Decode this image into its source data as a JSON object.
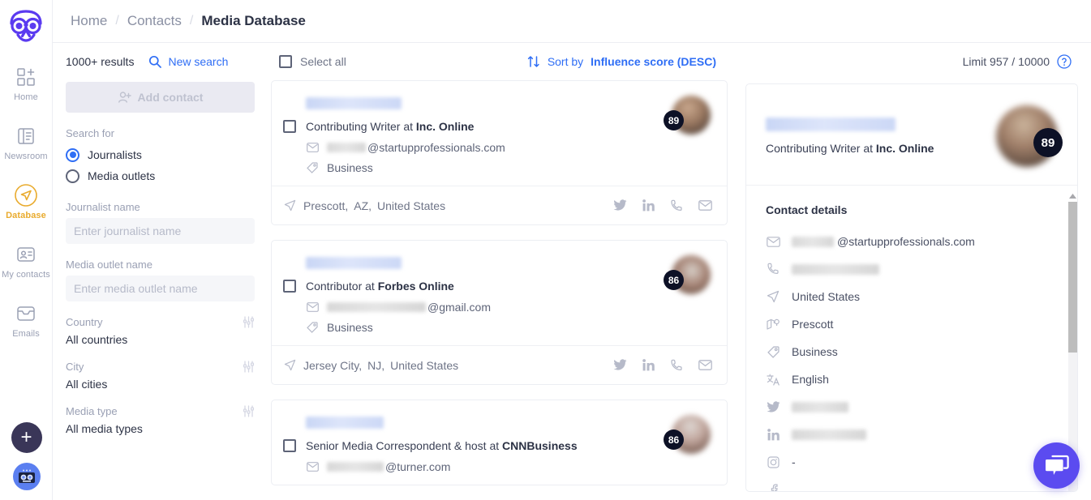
{
  "brand": {
    "logo_icon": "owl-logo",
    "accent_blue": "#2f6ef5",
    "accent_purple": "#5b4bf0",
    "accent_gold": "#e9ab2e",
    "score_bg": "#0d1126"
  },
  "sidebar": {
    "items": [
      {
        "label": "Home",
        "icon": "dashboard-add-icon",
        "active": false
      },
      {
        "label": "Newsroom",
        "icon": "book-icon",
        "active": false
      },
      {
        "label": "Database",
        "icon": "paper-plane-icon",
        "active": true
      },
      {
        "label": "My contacts",
        "icon": "contact-card-icon",
        "active": false
      },
      {
        "label": "Emails",
        "icon": "inbox-icon",
        "active": false
      }
    ],
    "add_button_icon": "plus-icon",
    "avatar_icon": "robot-avatar-icon"
  },
  "breadcrumb": {
    "items": [
      {
        "label": "Home"
      },
      {
        "label": "Contacts"
      },
      {
        "label": "Media Database"
      }
    ],
    "separator": "/"
  },
  "filters": {
    "results_count": "1000+ results",
    "new_search_label": "New search",
    "new_search_icon": "search-icon",
    "add_contact_label": "Add contact",
    "add_contact_icon": "person-add-icon",
    "search_for_label": "Search for",
    "radio_options": [
      {
        "label": "Journalists",
        "selected": true
      },
      {
        "label": "Media outlets",
        "selected": false
      }
    ],
    "journalist_name_label": "Journalist name",
    "journalist_name_placeholder": "Enter journalist name",
    "journalist_name_value": "",
    "media_outlet_label": "Media outlet name",
    "media_outlet_placeholder": "Enter media outlet name",
    "media_outlet_value": "",
    "groups": [
      {
        "title": "Country",
        "value": "All countries",
        "icon": "sliders-icon"
      },
      {
        "title": "City",
        "value": "All cities",
        "icon": "sliders-icon"
      },
      {
        "title": "Media type",
        "value": "All media types",
        "icon": "sliders-icon"
      }
    ]
  },
  "results_header": {
    "select_all_label": "Select all",
    "sort_icon": "sort-arrows-icon",
    "sort_prefix": "Sort by",
    "sort_value": "Influence score (DESC)",
    "limit_label": "Limit 957 / 10000",
    "help_icon": "question-mark-icon"
  },
  "results": [
    {
      "name_redacted": true,
      "title_prefix": "Contributing Writer at",
      "outlet": "Inc. Online",
      "email_redacted": true,
      "email_domain": "@startupprofessionals.com",
      "beat": "Business",
      "beat_icon": "tag-icon",
      "email_icon": "envelope-icon",
      "score": "89",
      "location_icon": "location-arrow-icon",
      "location": [
        "Prescott,",
        "AZ,",
        "United States"
      ],
      "actions": [
        "twitter-icon",
        "linkedin-icon",
        "phone-icon",
        "envelope-icon"
      ]
    },
    {
      "name_redacted": true,
      "title_prefix": "Contributor at",
      "outlet": "Forbes Online",
      "email_redacted": true,
      "email_domain": "@gmail.com",
      "beat": "Business",
      "beat_icon": "tag-icon",
      "email_icon": "envelope-icon",
      "score": "86",
      "location_icon": "location-arrow-icon",
      "location": [
        "Jersey City,",
        "NJ,",
        "United States"
      ],
      "actions": [
        "twitter-icon",
        "linkedin-icon",
        "phone-icon",
        "envelope-icon"
      ]
    },
    {
      "name_redacted": true,
      "title_prefix": "Senior Media Correspondent & host at",
      "outlet": "CNNBusiness",
      "email_redacted": true,
      "email_domain": "@turner.com",
      "beat": "",
      "beat_icon": "tag-icon",
      "email_icon": "envelope-icon",
      "score": "86",
      "location_icon": "location-arrow-icon",
      "location": [],
      "actions": []
    }
  ],
  "detail": {
    "name_redacted": true,
    "title_prefix": "Contributing Writer at",
    "outlet": "Inc. Online",
    "score": "89",
    "section_title": "Contact details",
    "rows": [
      {
        "icon": "envelope-icon",
        "redacted": true,
        "redact_width": 52,
        "text": "@startupprofessionals.com"
      },
      {
        "icon": "phone-icon",
        "redacted": true,
        "redact_width": 108,
        "text": ""
      },
      {
        "icon": "location-arrow-icon",
        "redacted": false,
        "redact_width": 0,
        "text": "United States"
      },
      {
        "icon": "map-pin-icon",
        "redacted": false,
        "redact_width": 0,
        "text": "Prescott"
      },
      {
        "icon": "tag-icon",
        "redacted": false,
        "redact_width": 0,
        "text": "Business"
      },
      {
        "icon": "translate-icon",
        "redacted": false,
        "redact_width": 0,
        "text": "English"
      },
      {
        "icon": "twitter-icon",
        "redacted": true,
        "redact_width": 70,
        "text": ""
      },
      {
        "icon": "linkedin-icon",
        "redacted": true,
        "redact_width": 92,
        "text": ""
      },
      {
        "icon": "instagram-icon",
        "redacted": false,
        "redact_width": 0,
        "text": "-"
      }
    ]
  },
  "chat_widget": {
    "icon": "chat-bubble-icon"
  }
}
